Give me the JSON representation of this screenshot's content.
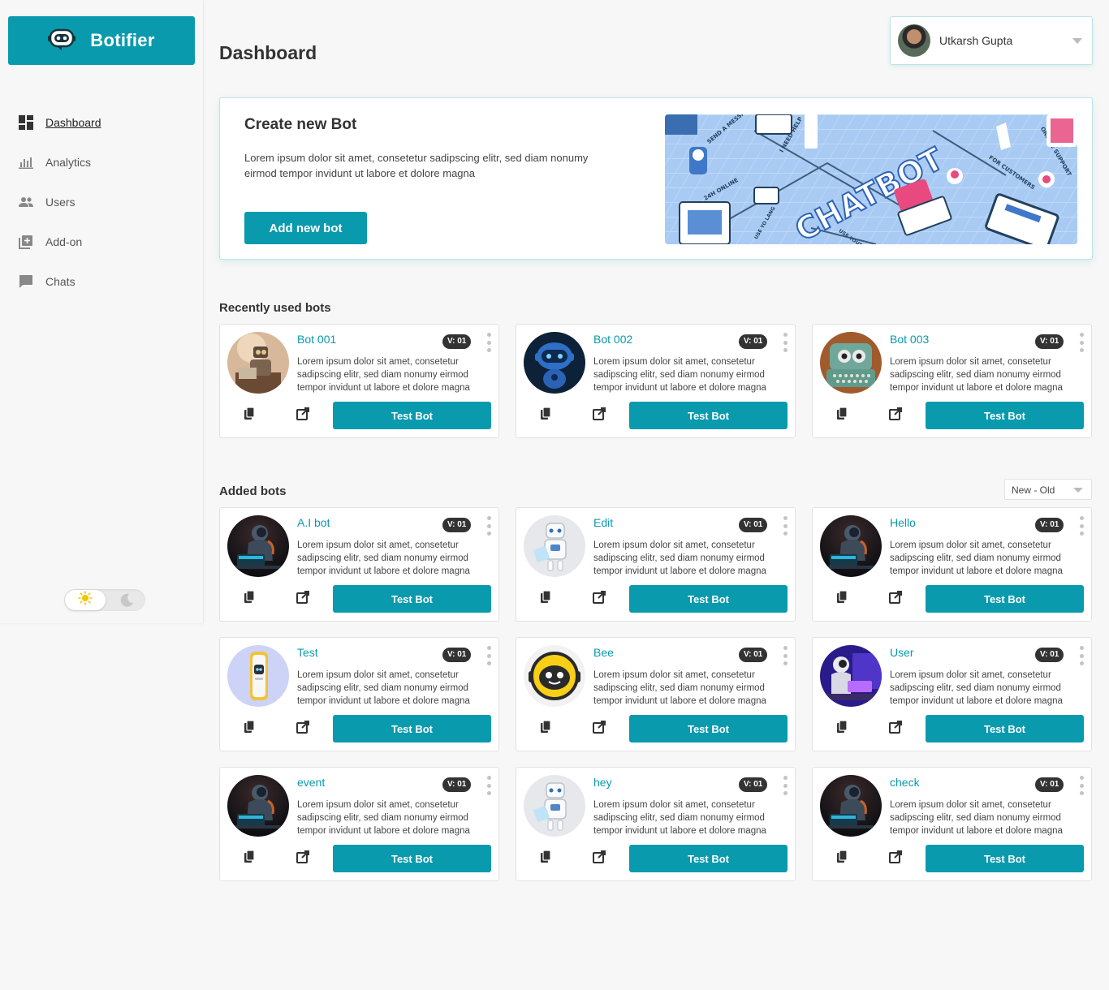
{
  "brand": {
    "name": "Botifier"
  },
  "nav": [
    {
      "label": "Dashboard",
      "icon": "dashboard-icon"
    },
    {
      "label": "Analytics",
      "icon": "analytics-icon"
    },
    {
      "label": "Users",
      "icon": "users-icon"
    },
    {
      "label": "Add-on",
      "icon": "add-on-icon"
    },
    {
      "label": "Chats",
      "icon": "chat-icon"
    }
  ],
  "header": {
    "title": "Dashboard",
    "user_name": "Utkarsh Gupta"
  },
  "create": {
    "title": "Create new Bot",
    "description": "Lorem ipsum dolor sit amet, consetetur sadipscing elitr, sed diam nonumy eirmod tempor invidunt ut labore et dolore magna",
    "button": "Add new bot"
  },
  "banner": {
    "chatbot": "CHATBOT",
    "send_message": "SEND A MESSAGE",
    "need_help": "I NEED HELP",
    "online_24h": "24H ONLINE",
    "online_support": "ONLINE SUPPORT",
    "for_customers": "FOR CUSTOMERS",
    "use_your": "USE YOUR",
    "use_your_lang": "USE YO LANG"
  },
  "sections": {
    "recent": "Recently used bots",
    "added": "Added bots",
    "sort": "New - Old"
  },
  "card_common": {
    "badge": "V: 01",
    "description": "Lorem ipsum dolor sit amet, consetetur sadipscing elitr, sed diam nonumy eirmod tempor invidunt ut labore et dolore magna",
    "test_button": "Test Bot"
  },
  "recent_bots": [
    {
      "name": "Bot 001",
      "avatar": "vintage-robot"
    },
    {
      "name": "Bot 002",
      "avatar": "blue-robot"
    },
    {
      "name": "Bot 003",
      "avatar": "typewriter-robot"
    }
  ],
  "added_bots": [
    {
      "name": "A.I bot",
      "avatar": "astronaut-laptop"
    },
    {
      "name": "Edit",
      "avatar": "white-robot"
    },
    {
      "name": "Hello",
      "avatar": "astronaut-laptop"
    },
    {
      "name": "Test",
      "avatar": "yellow-device"
    },
    {
      "name": "Bee",
      "avatar": "yellow-robot"
    },
    {
      "name": "User",
      "avatar": "purple-robot"
    },
    {
      "name": "event",
      "avatar": "astronaut-laptop"
    },
    {
      "name": "hey",
      "avatar": "white-robot"
    },
    {
      "name": "check",
      "avatar": "astronaut-laptop"
    }
  ],
  "colors": {
    "accent": "#0a9aad",
    "badge": "#333333",
    "background": "#f7f7f7"
  }
}
